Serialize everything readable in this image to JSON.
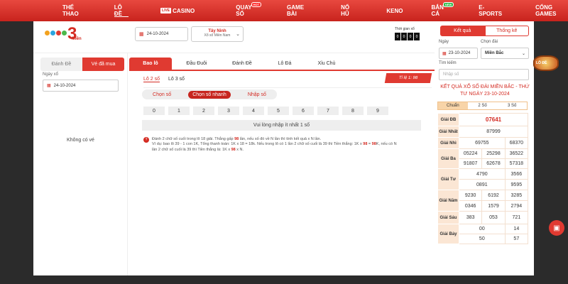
{
  "nav": {
    "items": [
      {
        "label": "THỂ THAO",
        "active": false
      },
      {
        "label": "LÔ ĐỀ",
        "active": true
      },
      {
        "label": "CASINO",
        "live": "LIVE"
      },
      {
        "label": "QUAY SỐ",
        "badge": "HOT"
      },
      {
        "label": "GAME BÀI"
      },
      {
        "label": "NỔ HŨ"
      },
      {
        "label": "KENO"
      },
      {
        "label": "BẮN CÁ",
        "badge": "NEW"
      },
      {
        "label": "E-SPORTS"
      },
      {
        "label": "CỔNG GAMES"
      }
    ]
  },
  "header": {
    "logo_number": "3",
    "logo_text": "Miền",
    "date": "24-10-2024",
    "province": "Tây Ninh",
    "province_sub": "Xổ số Miền Nam",
    "timer_label": "Thời gian xổ",
    "timer_blocks": [
      "0",
      "0",
      "0",
      "0"
    ]
  },
  "left": {
    "tabs": [
      "Đánh Đề",
      "Vé đã mua"
    ],
    "date_label": "Ngày xổ",
    "date": "24-10-2024",
    "empty": "Không có vé"
  },
  "center": {
    "tabs": [
      "Bao lô",
      "Đầu Đuôi",
      "Đánh Đề",
      "Lô Đá",
      "Xỉu Chủ"
    ],
    "subtabs": [
      "Lô 2 số",
      "Lô 3 số"
    ],
    "ratio": "Tỉ lệ 1: 98",
    "modes": [
      "Chọn số",
      "Chọn số nhanh",
      "Nhập số"
    ],
    "digits": [
      "0",
      "1",
      "2",
      "3",
      "4",
      "5",
      "6",
      "7",
      "8",
      "9"
    ],
    "warning": "Vui lòng nhập ít nhất 1 số",
    "help_line1_a": "Đánh 2 chữ số cuối trong lô 18 giải. Thắng gấp ",
    "help_line1_b": "98",
    "help_line1_c": " lần, nếu số đó về N lần thì tính kết quả x N lần.",
    "help_line2_a": "Ví dụ: bao lô 39 - 1 con 1K, Tổng thanh toán: 1K x 18 = 18k. Nếu trong lô có 1 lần 2 chữ số cuối là 39 thì Tiền thắng: 1K x ",
    "help_line2_b": "98",
    "help_line2_c": " = ",
    "help_line2_d": "98",
    "help_line2_e": "K, nếu có N",
    "help_line3_a": "lần 2 chữ số cuối là 39 thì Tiền thắng là: 1K x ",
    "help_line3_b": "98",
    "help_line3_c": " x N."
  },
  "right": {
    "tabs": [
      "Kết quả",
      "Thống kê"
    ],
    "date_label": "Ngày",
    "region_label": "Chọn đài",
    "date": "23-10-2024",
    "region": "Miền Bắc",
    "search_label": "Tìm kiếm",
    "search_placeholder": "Nhập số",
    "title": "KẾT QUẢ XỔ SỐ ĐÀI MIỀN BẮC - THỨ TƯ NGÀY 23-10-2024",
    "digit_modes": [
      "Chuẩn",
      "2 Số",
      "3 Số"
    ],
    "results": [
      {
        "label": "Giải ĐB",
        "values": [
          "07641"
        ]
      },
      {
        "label": "Giải Nhất",
        "values": [
          "87999"
        ]
      },
      {
        "label": "Giải Nhì",
        "values": [
          "69755",
          "68370"
        ]
      },
      {
        "label": "Giải Ba",
        "values": [
          "05224",
          "25298",
          "36522",
          "91807",
          "62678",
          "57318"
        ]
      },
      {
        "label": "Giải Tư",
        "values": [
          "4790",
          "3566",
          "0891",
          "9595"
        ]
      },
      {
        "label": "Giải Năm",
        "values": [
          "9230",
          "6192",
          "3285",
          "0346",
          "1579",
          "2794"
        ]
      },
      {
        "label": "Giải Sáu",
        "values": [
          "383",
          "053",
          "721"
        ]
      },
      {
        "label": "Giải Bảy",
        "values": [
          "00",
          "14",
          "50",
          "57"
        ]
      }
    ]
  },
  "float": {
    "logo_text": "LÔ ĐỀ"
  },
  "colors": {
    "primary": "#e03a31",
    "dark_red": "#c7261f",
    "peach": "#fbe6d4"
  }
}
